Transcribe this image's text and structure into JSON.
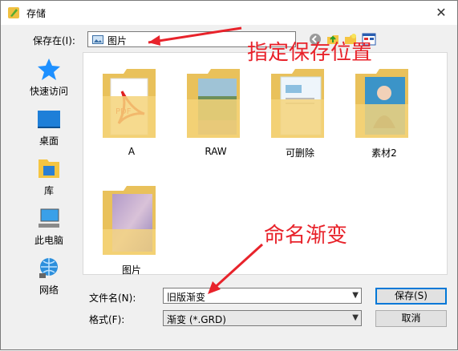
{
  "window": {
    "title": "存储"
  },
  "save_in": {
    "label": "保存在(I):",
    "value": "图片"
  },
  "sidebar": {
    "items": [
      {
        "label": "快速访问",
        "icon": "star-icon"
      },
      {
        "label": "桌面",
        "icon": "desktop-icon"
      },
      {
        "label": "库",
        "icon": "library-icon"
      },
      {
        "label": "此电脑",
        "icon": "computer-icon"
      },
      {
        "label": "网络",
        "icon": "network-icon"
      }
    ]
  },
  "files": [
    {
      "name": "A",
      "icon": "folder-pdf-icon"
    },
    {
      "name": "RAW",
      "icon": "folder-photo-icon"
    },
    {
      "name": "可删除",
      "icon": "folder-doc-icon"
    },
    {
      "name": "素材2",
      "icon": "folder-portrait-icon"
    },
    {
      "name": "图片",
      "icon": "folder-gradient-icon"
    }
  ],
  "filename": {
    "label": "文件名(N):",
    "value": "旧版渐变"
  },
  "format": {
    "label": "格式(F):",
    "value": "渐变 (*.GRD)"
  },
  "buttons": {
    "save": "保存(S)",
    "cancel": "取消"
  },
  "annotations": {
    "top": "指定保存位置",
    "bottom": "命名渐变"
  },
  "colors": {
    "annotation": "#e8232b",
    "accent": "#0078d7",
    "folder": "#f5d47a"
  }
}
